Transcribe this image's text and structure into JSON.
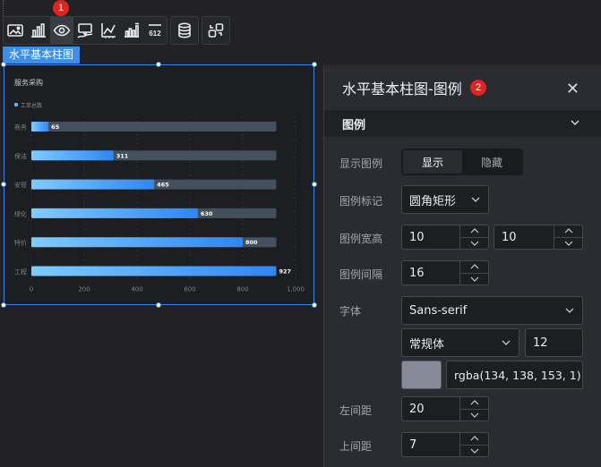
{
  "toolbar": {
    "badge": "1",
    "icons": [
      "image-icon",
      "bar-chart-icon",
      "eye-icon",
      "tooltip-icon",
      "axis-icon",
      "data-label-icon",
      "number-format-icon",
      "database-icon",
      "interaction-icon"
    ],
    "number_icon_text": "612"
  },
  "widget": {
    "tag": "水平基本柱图"
  },
  "chart_data": {
    "type": "bar",
    "orientation": "horizontal",
    "title": "服务采购",
    "legend": [
      "工单总数"
    ],
    "categories": [
      "工程",
      "特价",
      "绿化",
      "安管",
      "保洁",
      "商务"
    ],
    "values": [
      927,
      800,
      630,
      465,
      311,
      65
    ],
    "max_background": 927,
    "xticks": [
      "0",
      "200",
      "400",
      "600",
      "800",
      "1,000"
    ],
    "xlim": [
      0,
      1000
    ],
    "colors": {
      "bar_start": "#7fcbff",
      "bar_end": "#2f86f2",
      "track": "#44505e"
    }
  },
  "panel": {
    "title": "水平基本柱图-图例",
    "badge": "2",
    "section_title": "图例",
    "show_legend": {
      "label": "显示图例",
      "on": "显示",
      "off": "隐藏"
    },
    "legend_marker": {
      "label": "图例标记",
      "value": "圆角矩形"
    },
    "legend_size": {
      "label": "图例宽高",
      "width": "10",
      "height": "10"
    },
    "legend_gap": {
      "label": "图例间隔",
      "value": "16"
    },
    "font": {
      "label": "字体",
      "family": "Sans-serif",
      "weight": "常规体",
      "size": "12",
      "color": "rgba(134, 138, 153, 1)"
    },
    "left_margin": {
      "label": "左间距",
      "value": "20"
    },
    "top_margin": {
      "label": "上间距",
      "value": "7"
    }
  }
}
